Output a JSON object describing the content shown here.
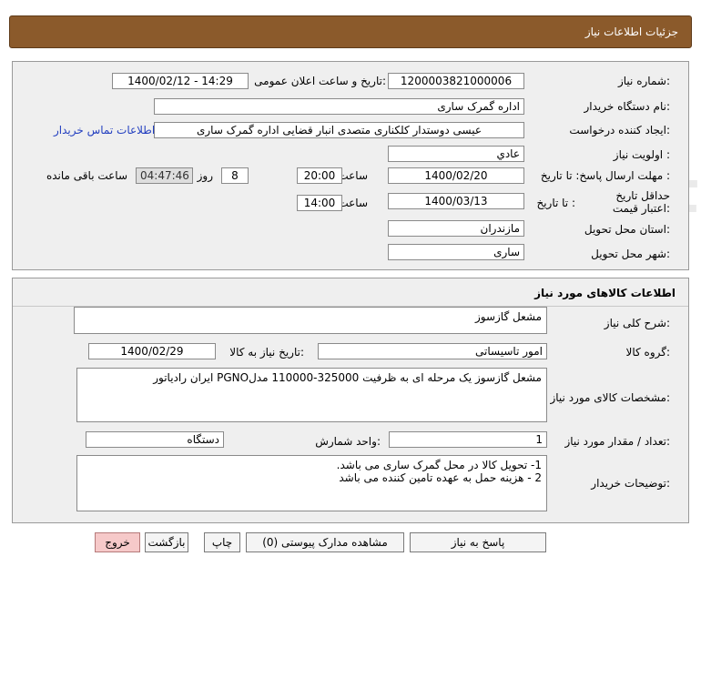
{
  "header": {
    "title": "جزئیات اطلاعات نیاز"
  },
  "need_info": {
    "need_number_label": "شماره نیاز:",
    "need_number": "1200003821000006",
    "announce_label": "تاریخ و ساعت اعلان عمومی:",
    "announce_value": "1400/02/12 - 14:29",
    "buyer_org_label": "نام دستگاه خریدار:",
    "buyer_org": "اداره گمرک ساری",
    "requester_label": "ایجاد کننده درخواست:",
    "requester": "عیسی دوستدار کلکناری متصدی انبار قضایی اداره گمرک ساری",
    "contact_link": "اطلاعات تماس خریدار",
    "priority_label": "اولویت نیاز :",
    "priority": "عادي",
    "deadline_label": "مهلت ارسال پاسخ:",
    "to_date_label": "تا تاریخ :",
    "deadline_date": "1400/02/20",
    "time_label": "ساعت",
    "deadline_time": "20:00",
    "days_value": "8",
    "days_label": "روز و",
    "remaining_time": "04:47:46",
    "remaining_label": "ساعت باقی مانده",
    "validity_label": "حداقل تاریخ اعتبار قیمت:",
    "validity_to_date_label": "تا تاریخ :",
    "validity_date": "1400/03/13",
    "validity_time_label": "ساعت",
    "validity_time": "14:00",
    "province_label": "استان محل تحویل:",
    "province": "مازندران",
    "city_label": "شهر محل تحویل:",
    "city": "ساری"
  },
  "goods": {
    "section_title": "اطلاعات کالاهای مورد نیاز",
    "general_desc_label": "شرح کلی نیاز:",
    "general_desc": "مشعل گازسوز",
    "group_label": "گروه کالا:",
    "group": "امور تاسیساتی",
    "need_date_label": "تاریخ نیاز به کالا:",
    "need_date": "1400/02/29",
    "spec_label": "مشخصات کالای مورد نیاز:",
    "spec": "مشعل گازسوز یک مرحله ای به ظرفیت 325000-110000 مدلPGNO ایران رادیاتور",
    "qty_label": "تعداد / مقدار مورد نیاز:",
    "qty": "1",
    "unit_label": "واحد شمارش:",
    "unit": "دستگاه",
    "buyer_notes_label": "توضیحات خریدار:",
    "buyer_notes_1": "1- تحویل کالا در محل گمرک ساری می باشد.",
    "buyer_notes_2": "2 - هزینه حمل به عهده تامین کننده می باشد"
  },
  "buttons": {
    "respond": "پاسخ به نیاز",
    "attachments": "مشاهده مدارک پیوستی (0)",
    "print": "چاپ",
    "back": "بازگشت",
    "exit": "خروج"
  },
  "watermark": {
    "line1": "مرکز فرآوری اطلاعات پارس نماد داده ها",
    "line2": "پایگاه اطلاع رسانی مناقصه و مزایده",
    "phone": "۰۲۱-۸۸۳۴۹۶۷۰",
    "brand": "ParsNamadData"
  },
  "colors": {
    "header_bg": "#8b5a2b",
    "panel_bg": "#efefef",
    "link": "#2440c0",
    "exit_btn": "#f6c9c9"
  }
}
